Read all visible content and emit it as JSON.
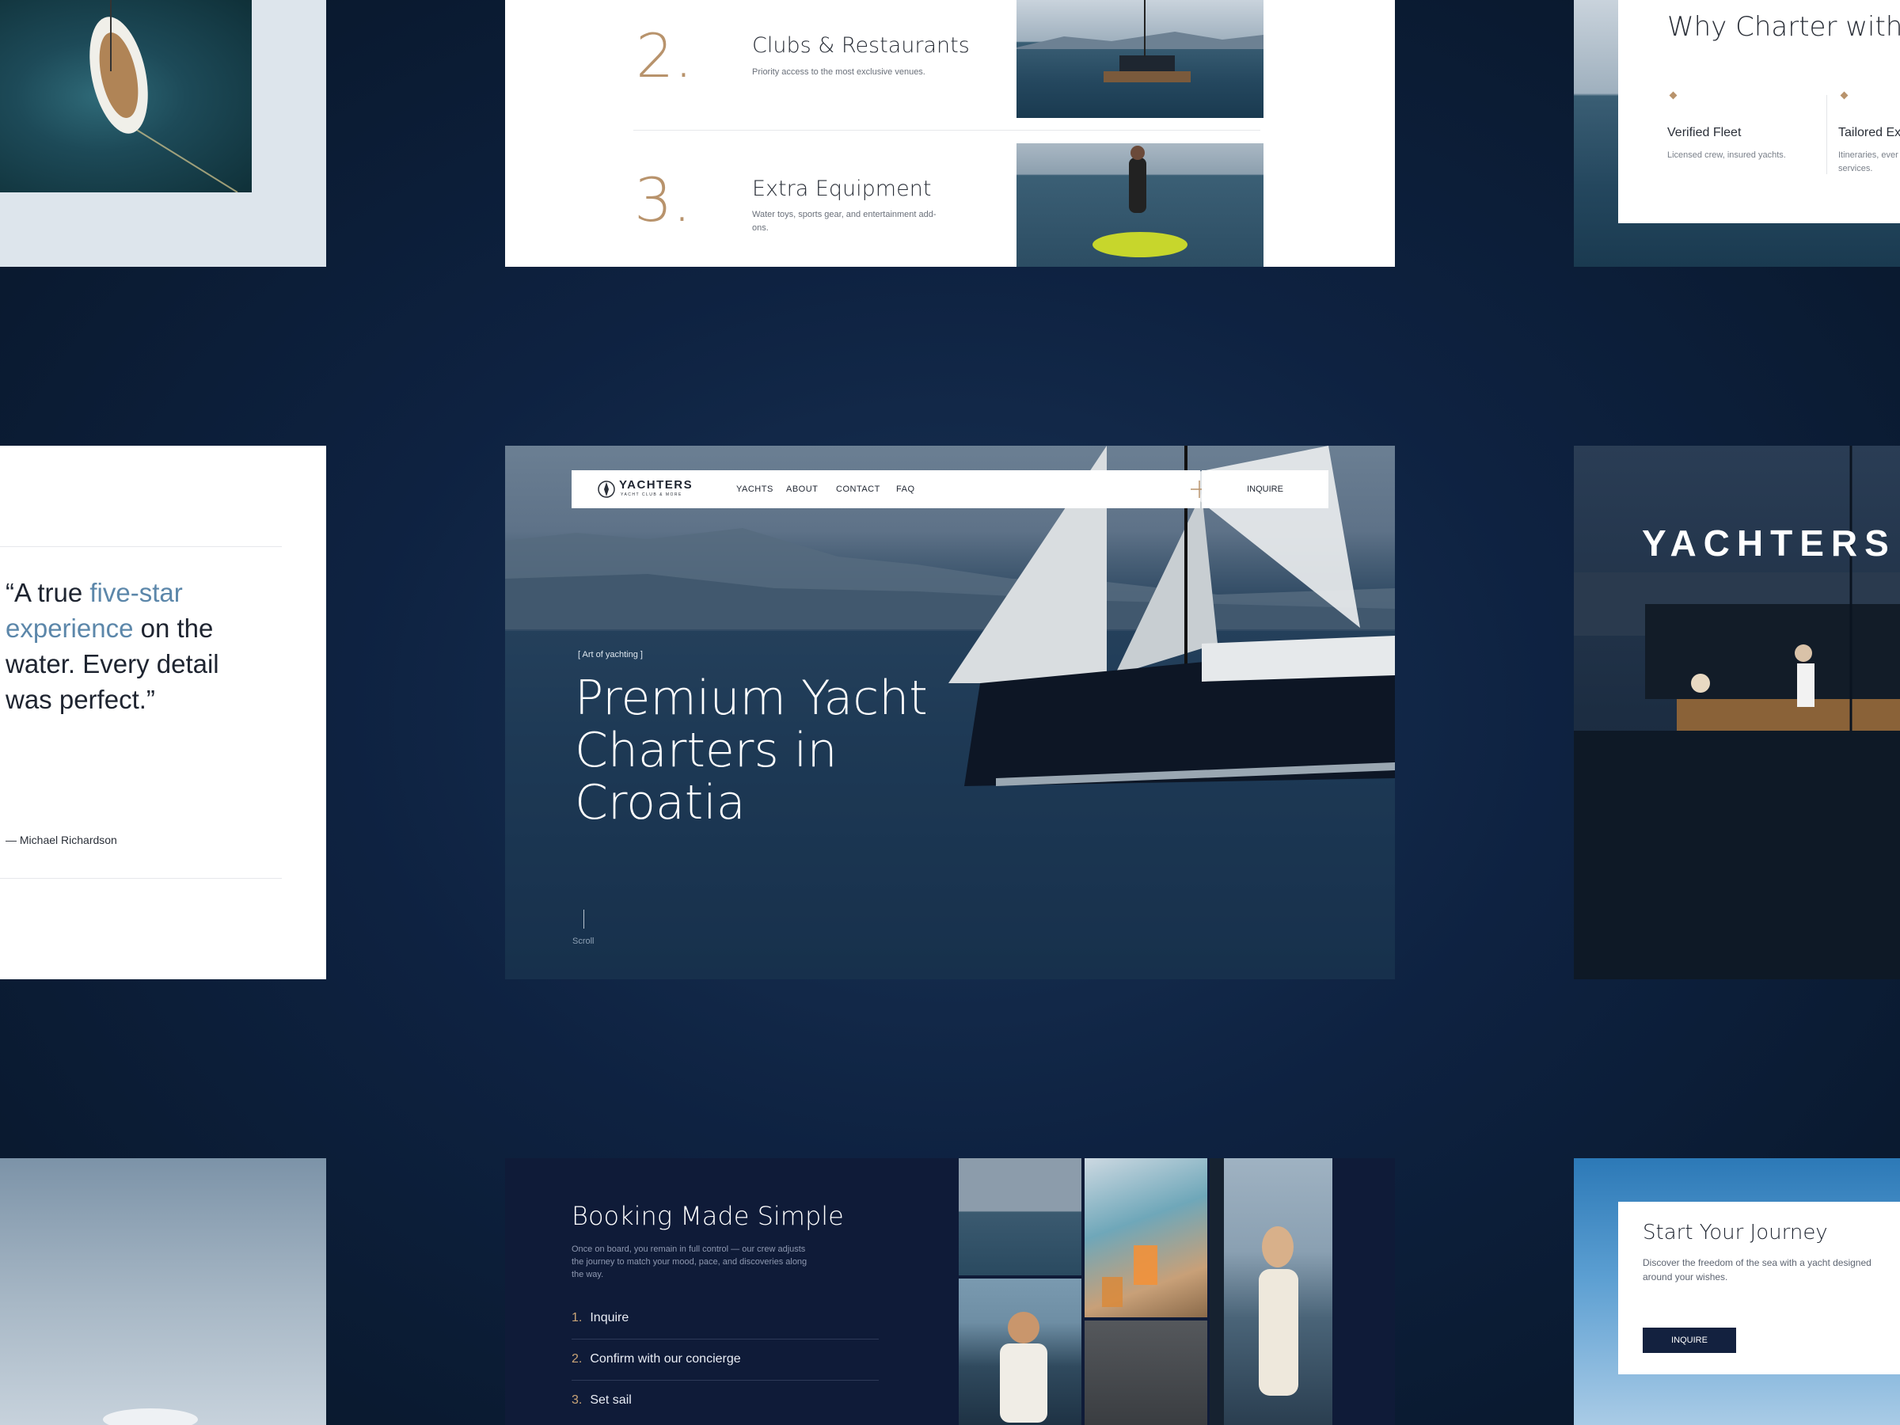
{
  "top_list": {
    "items": [
      {
        "num": "2.",
        "title": "Clubs & Restaurants",
        "desc": "Priority access to the most exclusive venues."
      },
      {
        "num": "3.",
        "title": "Extra Equipment",
        "desc": "Water toys, sports gear, and entertainment add-ons."
      }
    ]
  },
  "why": {
    "title": "Why Charter with Us",
    "features": [
      {
        "title": "Verified Fleet",
        "desc": "Licensed crew, insured yachts."
      },
      {
        "title": "Tailored Ex",
        "desc": "Itineraries, ever services."
      }
    ]
  },
  "testimonial": {
    "open": "“A true ",
    "highlight": "five-star experience",
    "rest": " on the water. Every detail was perfect.”",
    "author": "— Michael Richardson"
  },
  "hero": {
    "brand": "YACHTERS",
    "brand_sub": "YACHT CLUB & MORE",
    "nav": [
      "YACHTS",
      "ABOUT",
      "CONTACT",
      "FAQ"
    ],
    "cta": "INQUIRE",
    "eyebrow": "[ Art of yachting ]",
    "headline_1": "Premium Yacht",
    "headline_2": "Charters in Croatia",
    "scroll": "Scroll"
  },
  "side_brand": "YACHTERS",
  "booking": {
    "title": "Booking Made Simple",
    "desc": "Once on board, you remain in full control — our crew adjusts the journey to match your mood, pace, and discoveries along the way.",
    "steps": [
      {
        "num": "1.",
        "label": "Inquire"
      },
      {
        "num": "2.",
        "label": "Confirm with our concierge"
      },
      {
        "num": "3.",
        "label": "Set sail"
      }
    ]
  },
  "journey": {
    "title": "Start Your Journey",
    "desc": "Discover the freedom of the sea with a yacht designed around your wishes.",
    "cta": "INQUIRE"
  },
  "colors": {
    "accent": "#b8936c",
    "navy": "#0f1b38",
    "quote_highlight": "#5c87aa"
  }
}
